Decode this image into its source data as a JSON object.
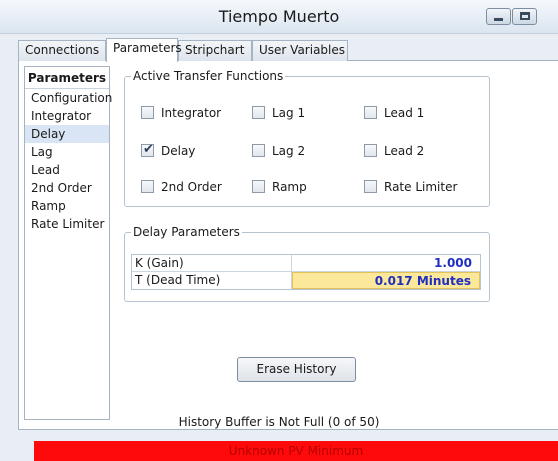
{
  "window": {
    "title": "Tiempo Muerto"
  },
  "tabs": [
    "Connections",
    "Parameters",
    "Stripchart",
    "User Variables"
  ],
  "active_tab": "Parameters",
  "sidebar": {
    "header": "Parameters",
    "items": [
      "Configuration",
      "Integrator",
      "Delay",
      "Lag",
      "Lead",
      "2nd Order",
      "Ramp",
      "Rate Limiter"
    ],
    "selected": "Delay"
  },
  "transfer_functions": {
    "title": "Active Transfer Functions",
    "items": [
      {
        "label": "Integrator",
        "checked": false
      },
      {
        "label": "Lag 1",
        "checked": false
      },
      {
        "label": "Lead 1",
        "checked": false
      },
      {
        "label": "Delay",
        "checked": true
      },
      {
        "label": "Lag 2",
        "checked": false
      },
      {
        "label": "Lead 2",
        "checked": false
      },
      {
        "label": "2nd Order",
        "checked": false
      },
      {
        "label": "Ramp",
        "checked": false
      },
      {
        "label": "Rate Limiter",
        "checked": false
      }
    ]
  },
  "delay_parameters": {
    "title": "Delay Parameters",
    "rows": [
      {
        "name": "K (Gain)",
        "value": "1.000"
      },
      {
        "name": "T (Dead Time)",
        "value": "0.017 Minutes"
      }
    ]
  },
  "erase_button": "Erase History",
  "history_status": "History Buffer is Not Full (0 of 50)",
  "alarm": "Unknown PV Minimum",
  "colors": {
    "alarm_bg": "#ff0a0a",
    "value_text": "#1f2fbf",
    "highlight": "#fce89b",
    "selection": "#d9e5f5"
  }
}
